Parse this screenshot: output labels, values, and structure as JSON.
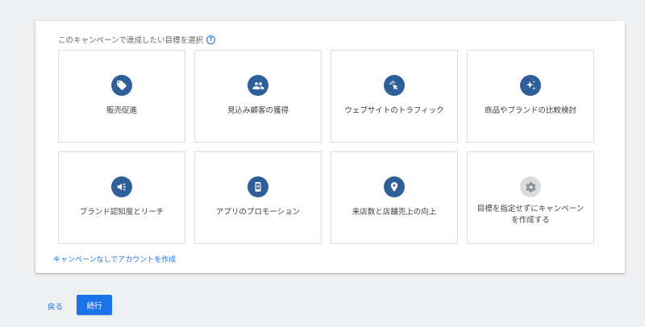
{
  "campaign_goal": {
    "prompt": "このキャンペーンで達成したい目標を選択",
    "help_icon": "help-circle-icon",
    "tiles": [
      {
        "label": "販売促進",
        "icon": "tag-icon"
      },
      {
        "label": "見込み顧客の獲得",
        "icon": "people-icon"
      },
      {
        "label": "ウェブサイトのトラフィック",
        "icon": "cursor-click-icon"
      },
      {
        "label": "商品やブランドの比較検討",
        "icon": "sparkle-icon"
      },
      {
        "label": "ブランド認知度とリーチ",
        "icon": "megaphone-icon"
      },
      {
        "label": "アプリのプロモーション",
        "icon": "phone-icon"
      },
      {
        "label": "来店数と店舗売上の向上",
        "icon": "location-pin-icon"
      },
      {
        "label": "目標を指定せずにキャンペーンを作成する",
        "icon": "gear-icon"
      }
    ],
    "no_campaign_link": "キャンペーンなしでアカウントを作成"
  },
  "footer": {
    "back_label": "戻る",
    "continue_label": "続行"
  },
  "colors": {
    "accent": "#1a73e8",
    "icon_bg": "#2f5f99",
    "icon_bg_muted": "#dadce0",
    "tile_border": "#dadce0",
    "page_bg": "#eef0f2"
  }
}
